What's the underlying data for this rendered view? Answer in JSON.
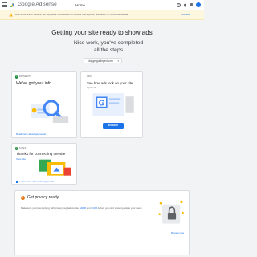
{
  "header": {
    "brand": "Google AdSense",
    "nav_title": "Home"
  },
  "banner": {
    "text": "Due to the war in Ukraine, we will pause monetization of content that exploits, dismisses, or condones the war.",
    "dismiss_label": "Dismiss"
  },
  "main": {
    "title": "Getting your site ready to show ads",
    "subtitle": "Nice work, you've completed all the steps",
    "site": "bloggerguideperi.com"
  },
  "cards": {
    "payments": {
      "status": "PAYMENTS",
      "title": "We've got your info",
      "link": "Read more about payments"
    },
    "ads": {
      "status": "ADS",
      "title": "See how ads look on your site",
      "desc": "Optional",
      "button": "Explore"
    },
    "sites": {
      "status": "SITES",
      "title": "Thanks for connecting the site",
      "view_link": "View site",
      "link": "Learn more about site approvals"
    }
  },
  "privacy": {
    "title": "Get privacy ready",
    "text_before": "Make sure you're complying with privacy regulations like ",
    "gdpr": "GDPR",
    "and": " and ",
    "ccpa": "CCPA",
    "text_after": " before you start showing ads to your users.",
    "review_link": "Review now"
  },
  "colors": {
    "accent": "#1a73e8",
    "success": "#1e8e3e",
    "warning": "#f9ab00",
    "privacy": "#e8710a"
  }
}
